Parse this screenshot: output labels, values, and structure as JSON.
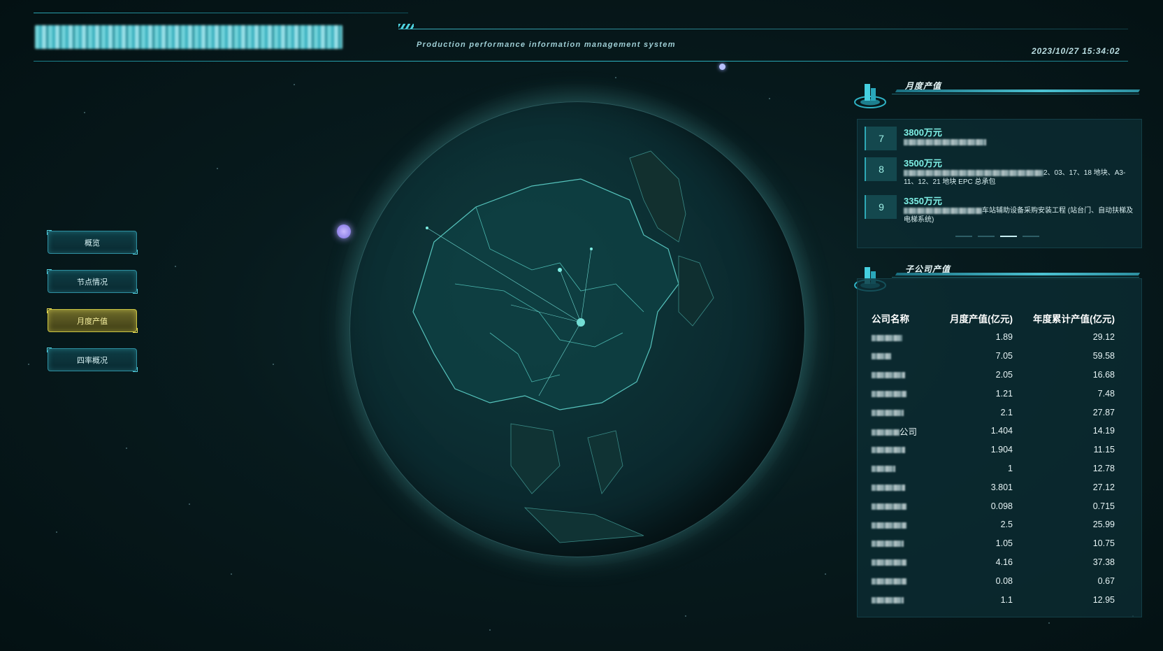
{
  "header": {
    "subtitle": "Production performance information management system",
    "datetime": "2023/10/27 15:34:02"
  },
  "nav": [
    {
      "label": "概览",
      "active": false
    },
    {
      "label": "节点情况",
      "active": false
    },
    {
      "label": "月度产值",
      "active": true
    },
    {
      "label": "四率概况",
      "active": false
    }
  ],
  "monthly_panel": {
    "title": "月度产值",
    "items": [
      {
        "rank": "7",
        "value": "3800万元",
        "desc_visible": ""
      },
      {
        "rank": "8",
        "value": "3500万元",
        "desc_visible": "2、03、17、18 地块、A3-11、12、21 地块 EPC 总承包"
      },
      {
        "rank": "9",
        "value": "3350万元",
        "desc_visible": "车站辅助设备采购安装工程 (站台门、自动扶梯及电梯系统)"
      }
    ],
    "pages": 4,
    "current_page": 3
  },
  "subsidiary_panel": {
    "title": "子公司产值",
    "headers": [
      "公司名称",
      "月度产值(亿元)",
      "年度累计产值(亿元)"
    ],
    "rows": [
      {
        "name": "",
        "monthly": "1.89",
        "annual": "29.12"
      },
      {
        "name": "",
        "monthly": "7.05",
        "annual": "59.58"
      },
      {
        "name": "",
        "monthly": "2.05",
        "annual": "16.68"
      },
      {
        "name": "",
        "monthly": "1.21",
        "annual": "7.48"
      },
      {
        "name": "",
        "monthly": "2.1",
        "annual": "27.87"
      },
      {
        "name": "公司",
        "monthly": "1.404",
        "annual": "14.19"
      },
      {
        "name": "",
        "monthly": "1.904",
        "annual": "11.15"
      },
      {
        "name": "",
        "monthly": "1",
        "annual": "12.78"
      },
      {
        "name": "",
        "monthly": "3.801",
        "annual": "27.12"
      },
      {
        "name": "",
        "monthly": "0.098",
        "annual": "0.715"
      },
      {
        "name": "",
        "monthly": "2.5",
        "annual": "25.99"
      },
      {
        "name": "",
        "monthly": "1.05",
        "annual": "10.75"
      },
      {
        "name": "",
        "monthly": "4.16",
        "annual": "37.38"
      },
      {
        "name": "",
        "monthly": "0.08",
        "annual": "0.67"
      },
      {
        "name": "",
        "monthly": "1.1",
        "annual": "12.95"
      }
    ]
  },
  "colors": {
    "accent": "#4cc2d2",
    "active_nav": "#c9c341",
    "value_text": "#7ff0e6"
  }
}
